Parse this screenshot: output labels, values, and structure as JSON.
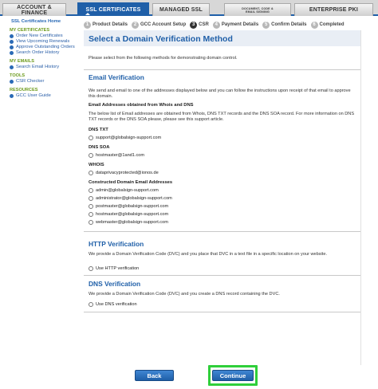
{
  "tabs": [
    {
      "label": "ACCOUNT & FINANCE",
      "active": false
    },
    {
      "label": "SSL CERTIFICATES",
      "active": true
    },
    {
      "label": "MANAGED SSL",
      "active": false
    },
    {
      "label": "DOCUMENT, CODE & EMAIL SIGNING",
      "active": false
    },
    {
      "label": "ENTERPRISE PKI",
      "active": false
    }
  ],
  "sidebar": {
    "home": "SSL Certificates Home",
    "sections": [
      {
        "title": "MY CERTIFICATES",
        "items": [
          "Order New Certificates",
          "View Upcoming Renewals",
          "Approve Outstanding Orders",
          "Search Order History"
        ]
      },
      {
        "title": "MY EMAILS",
        "items": [
          "Search Email History"
        ]
      },
      {
        "title": "TOOLS",
        "items": [
          "CSR Checker"
        ]
      },
      {
        "title": "RESOURCES",
        "items": [
          "GCC User Guide"
        ]
      }
    ]
  },
  "steps": [
    {
      "num": "1",
      "label": "Product Details"
    },
    {
      "num": "2",
      "label": "GCC Account Setup"
    },
    {
      "num": "3",
      "label": "CSR"
    },
    {
      "num": "4",
      "label": "Payment Details"
    },
    {
      "num": "5",
      "label": "Confirm Details"
    },
    {
      "num": "6",
      "label": "Completed"
    }
  ],
  "page_title": "Select a Domain Verification Method",
  "intro": "Please select from the following methods for demonstrating domain control.",
  "email": {
    "title": "Email Verification",
    "desc": "We send and email to one of the addresses displayed below and you can follow the instructions upon receipt of that email to approve this domain.",
    "whois_head": "Email Addresses obtained from Whois and DNS",
    "whois_desc": "The below list of Email addresses are obtained from Whois, DNS TXT records and the DNS SOA record. For more information on DNS TXT records or the DNS SOA please, please see this support article.",
    "dns_txt_head": "DNS TXT",
    "dns_txt": "support@globalsign-support.com",
    "dns_soa_head": "DNS SOA",
    "dns_soa": "hostmaster@1and1.com",
    "whois_label": "WHOIS",
    "whois": "dataprivacyprotected@ionos.de",
    "constructed_head": "Constructed Domain Email Addresses",
    "constructed": [
      "admin@globalsign-support.com",
      "administrator@globalsign-support.com",
      "postmaster@globalsign-support.com",
      "hostmaster@globalsign-support.com",
      "webmaster@globalsign-support.com"
    ]
  },
  "http": {
    "title": "HTTP Verification",
    "desc": "We provide a Domain Verification Code (DVC) and you place that DVC in a text file in a specific location on your website.",
    "option": "Use HTTP verification"
  },
  "dns": {
    "title": "DNS Verification",
    "desc": "We provide a Domain Verification Code (DVC) and you create a DNS record containing the DVC.",
    "option": "Use DNS verification"
  },
  "buttons": {
    "back": "Back",
    "continue": "Continue"
  },
  "colors": {
    "accent": "#1f5fa8",
    "sidebar_head": "#6c9a1c",
    "highlight": "#2fcf3a"
  }
}
